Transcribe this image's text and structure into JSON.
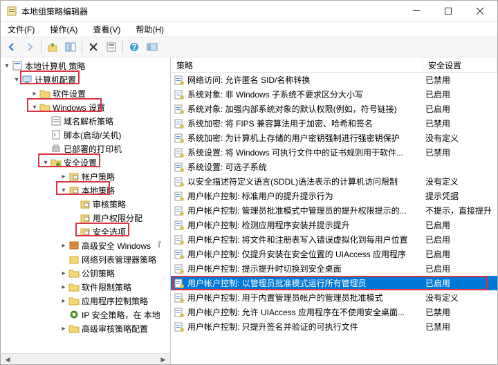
{
  "window": {
    "title": "本地组策略编辑器"
  },
  "menu": {
    "file": "文件(F)",
    "action": "操作(A)",
    "view": "查看(V)",
    "help": "帮助(H)"
  },
  "tree": {
    "root": "本地计算机 策略",
    "computer": "计算机配置",
    "software": "软件设置",
    "windows": "Windows 设置",
    "dns": "域名解析策略",
    "scripts": "脚本(启动/关机)",
    "printers": "已部署的打印机",
    "security": "安全设置",
    "account": "帐户策略",
    "local": "本地策略",
    "audit": "审核策略",
    "rights": "用户权限分配",
    "options": "安全选项",
    "advwin": "高级安全 Windows 『",
    "netlist": "网络列表管理器策略",
    "pubkey": "公钥策略",
    "softrest": "软件限制策略",
    "appctrl": "应用程序控制策略",
    "ipsec": "IP 安全策略，在 本地",
    "advaudit": "高级审核策略配置"
  },
  "list": {
    "col_policy": "策略",
    "col_setting": "安全设置",
    "rows": [
      {
        "p": "网络访问: 允许匿名 SID/名称转换",
        "s": "已禁用"
      },
      {
        "p": "系统对象: 非 Windows 子系统不要求区分大小写",
        "s": "已启用"
      },
      {
        "p": "系统对象: 加强内部系统对象的默认权限(例如，符号链接)",
        "s": "已启用"
      },
      {
        "p": "系统加密: 将 FIPS 兼容算法用于加密、哈希和签名",
        "s": "已禁用"
      },
      {
        "p": "系统加密: 为计算机上存储的用户密钥强制进行强密钥保护",
        "s": "没有定义"
      },
      {
        "p": "系统设置: 将 Windows 可执行文件中的证书规则用于软件...",
        "s": "已禁用"
      },
      {
        "p": "系统设置: 可选子系统",
        "s": ""
      },
      {
        "p": "以安全描述符定义语言(SDDL)语法表示的计算机访问限制",
        "s": "没有定义"
      },
      {
        "p": "用户帐户控制: 标准用户的提升提示行为",
        "s": "提示凭据"
      },
      {
        "p": "用户帐户控制: 管理员批准模式中管理员的提升权限提示的...",
        "s": "不提示，直接提升"
      },
      {
        "p": "用户帐户控制: 检测应用程序安装并提示提升",
        "s": "已启用"
      },
      {
        "p": "用户帐户控制: 将文件和注册表写入错误虚拟化到每用户位置",
        "s": "已启用"
      },
      {
        "p": "用户帐户控制: 仅提升安装在安全位置的 UIAccess 应用程序",
        "s": "已启用"
      },
      {
        "p": "用户帐户控制: 提示提升时切换到安全桌面",
        "s": "已启用"
      },
      {
        "p": "用户帐户控制: 以管理员批准模式运行所有管理员",
        "s": "已启用"
      },
      {
        "p": "用户帐户控制: 用于内置管理员帐户的管理员批准模式",
        "s": "没有定义"
      },
      {
        "p": "用户帐户控制: 允许 UIAccess 应用程序在不使用安全桌面...",
        "s": "已禁用"
      },
      {
        "p": "用户帐户控制: 只提升签名并验证的可执行文件",
        "s": "已禁用"
      }
    ],
    "selected_index": 14
  }
}
